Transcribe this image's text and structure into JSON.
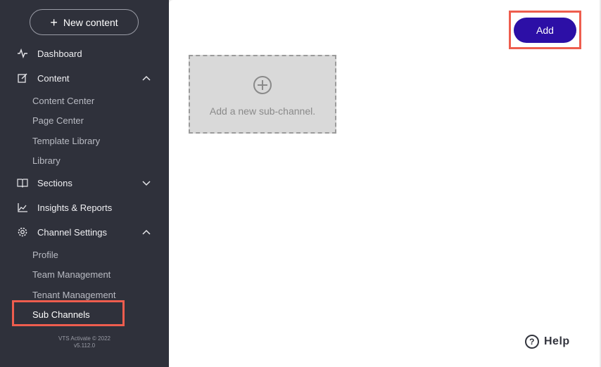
{
  "sidebar": {
    "new_content_label": "New content",
    "items": [
      {
        "label": "Dashboard"
      },
      {
        "label": "Content"
      },
      {
        "label": "Sections"
      },
      {
        "label": "Insights & Reports"
      },
      {
        "label": "Channel Settings"
      }
    ],
    "content_sub": [
      "Content Center",
      "Page Center",
      "Template Library",
      "Library"
    ],
    "settings_sub": [
      "Profile",
      "Team Management",
      "Tenant Management",
      "Sub Channels"
    ],
    "version_line1": "VTS Activate © 2022",
    "version_line2": "v5.112.0"
  },
  "main": {
    "add_label": "Add",
    "card_text": "Add a new sub-channel."
  },
  "help": {
    "label": "Help",
    "icon": "?"
  },
  "colors": {
    "sidebar_bg": "#2f313b",
    "accent": "#2c0fa6",
    "highlight": "#ee5d4e"
  }
}
